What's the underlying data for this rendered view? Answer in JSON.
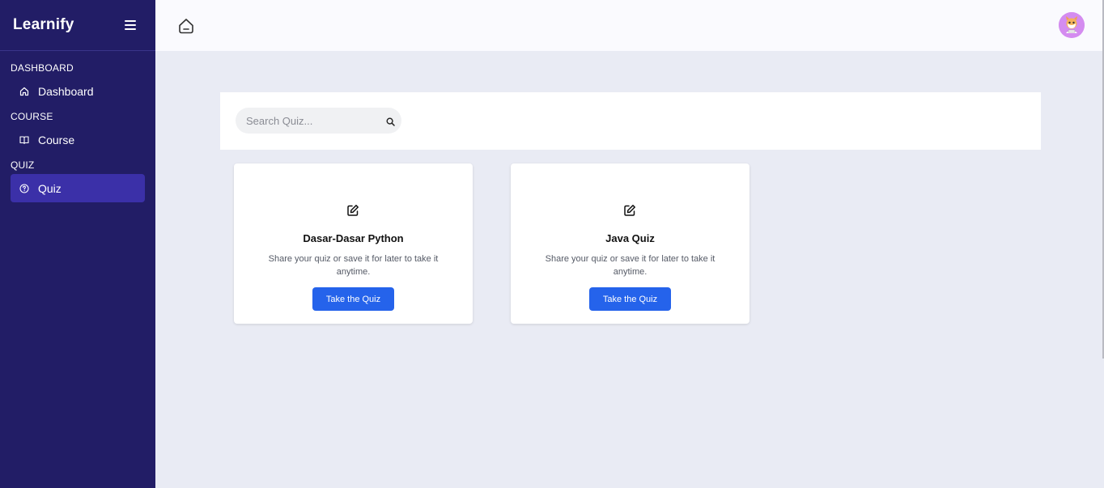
{
  "sidebar": {
    "brand": "Learnify",
    "sections": [
      {
        "heading": "DASHBOARD",
        "item": {
          "label": "Dashboard",
          "icon": "home-icon"
        }
      },
      {
        "heading": "COURSE",
        "item": {
          "label": "Course",
          "icon": "book-open-icon"
        }
      },
      {
        "heading": "QUIZ",
        "item": {
          "label": "Quiz",
          "icon": "question-circle-icon",
          "active": true
        }
      }
    ]
  },
  "topbar": {
    "home_icon": "home-icon",
    "avatar_icon": "user-avatar"
  },
  "search": {
    "placeholder": "Search Quiz...",
    "value": ""
  },
  "quizzes": [
    {
      "title": "Dasar-Dasar Python",
      "description": "Share your quiz or save it for later to take it anytime.",
      "button": "Take the Quiz"
    },
    {
      "title": "Java Quiz",
      "description": "Share your quiz or save it for later to take it anytime.",
      "button": "Take the Quiz"
    }
  ],
  "colors": {
    "sidebar_bg": "#221d66",
    "active_item": "#3b30a8",
    "primary_button": "#2563eb",
    "page_bg": "#e9ebf4"
  }
}
